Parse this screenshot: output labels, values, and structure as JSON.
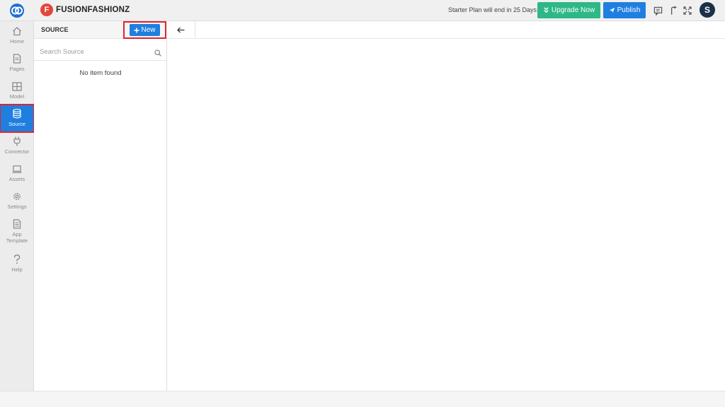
{
  "app": {
    "name": "FUSIONFASHIONZ",
    "badge_letter": "F",
    "brand_color": "#e5453a"
  },
  "header": {
    "plan_text": "Starter Plan will end in 25 Days",
    "upgrade_label": "Upgrade Now",
    "publish_label": "Publish",
    "avatar_letter": "S",
    "icons": [
      "comment-icon",
      "share-icon",
      "fullscreen-icon"
    ]
  },
  "sidebar": {
    "items": [
      {
        "label": "Home",
        "icon": "home-icon"
      },
      {
        "label": "Pages",
        "icon": "page-icon"
      },
      {
        "label": "Model",
        "icon": "table-icon"
      },
      {
        "label": "Source",
        "icon": "database-icon",
        "active": true
      },
      {
        "label": "Connector",
        "icon": "plug-icon"
      },
      {
        "label": "Assets",
        "icon": "laptop-icon"
      },
      {
        "label": "Settings",
        "icon": "gear-icon"
      },
      {
        "label": "App Template",
        "icon": "document-icon"
      },
      {
        "label": "Help",
        "icon": "help-icon"
      }
    ]
  },
  "source_panel": {
    "title": "SOURCE",
    "new_label": "New",
    "search_placeholder": "Search Source",
    "empty_text": "No item found"
  },
  "colors": {
    "primary": "#1f7fe0",
    "upgrade": "#2fb887",
    "highlight": "#e0242e",
    "avatar": "#1b3147"
  }
}
